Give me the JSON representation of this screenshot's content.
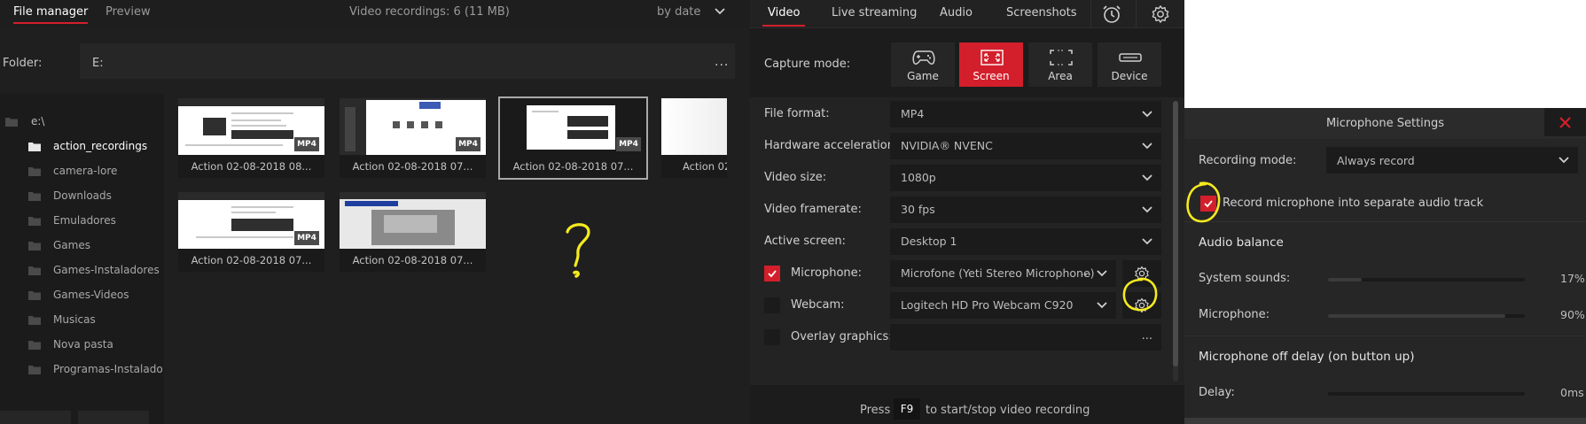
{
  "file_manager": {
    "tabs": [
      {
        "label": "File manager",
        "active": true
      },
      {
        "label": "Preview",
        "active": false
      }
    ],
    "recordings_count": "Video recordings: 6 (11 MB)",
    "sort": "by date",
    "folder_label": "Folder:",
    "folder_value": "E:",
    "folder_browse": "...",
    "tree": [
      {
        "label": "e:\\",
        "root": true
      },
      {
        "label": "action_recordings",
        "selected": true
      },
      {
        "label": "camera-lore"
      },
      {
        "label": "Downloads"
      },
      {
        "label": "Emuladores"
      },
      {
        "label": "Games"
      },
      {
        "label": "Games-Instaladores"
      },
      {
        "label": "Games-Videos"
      },
      {
        "label": "Musicas"
      },
      {
        "label": "Nova pasta"
      },
      {
        "label": "Programas-Instalado"
      }
    ],
    "thumbnails": [
      {
        "caption": "Action 02-08-2018 08...",
        "badge": "MP4"
      },
      {
        "caption": "Action 02-08-2018 07...",
        "badge": "MP4"
      },
      {
        "caption": "Action 02-08-2018 07...",
        "badge": "MP4",
        "selected": true
      },
      {
        "caption": "Action 02",
        "badge": ""
      },
      {
        "caption": "Action 02-08-2018 07...",
        "badge": "MP4"
      },
      {
        "caption": "Action 02-08-2018 07...",
        "badge": ""
      }
    ],
    "annotation_mark": "?"
  },
  "video_panel": {
    "tabs": [
      {
        "label": "Video",
        "active": true
      },
      {
        "label": "Live streaming"
      },
      {
        "label": "Audio"
      },
      {
        "label": "Screenshots"
      }
    ],
    "capture_label": "Capture mode:",
    "capture_modes": [
      {
        "label": "Game",
        "icon": "gamepad-icon"
      },
      {
        "label": "Screen",
        "icon": "screen-capture-icon",
        "active": true
      },
      {
        "label": "Area",
        "icon": "area-capture-icon"
      },
      {
        "label": "Device",
        "icon": "device-icon"
      }
    ],
    "settings": {
      "file_format": {
        "label": "File format:",
        "value": "MP4"
      },
      "hw_accel": {
        "label": "Hardware acceleration:",
        "value": "NVIDIA® NVENC"
      },
      "video_size": {
        "label": "Video size:",
        "value": "1080p"
      },
      "framerate": {
        "label": "Video framerate:",
        "value": "30 fps"
      },
      "active_screen": {
        "label": "Active screen:",
        "value": "Desktop 1"
      },
      "microphone": {
        "label": "Microphone:",
        "value": "Microfone (Yeti Stereo Microphone)",
        "more": "...",
        "checked": true
      },
      "webcam": {
        "label": "Webcam:",
        "value": "Logitech HD Pro Webcam C920",
        "checked": false
      },
      "overlay": {
        "label": "Overlay graphics:",
        "value": "",
        "more": "...",
        "checked": false
      }
    },
    "footer": {
      "press": "Press",
      "key": "F9",
      "rest": "to start/stop video recording"
    }
  },
  "mic_settings": {
    "title": "Microphone Settings",
    "recording_mode_label": "Recording mode:",
    "recording_mode_value": "Always record",
    "separate_track_label": "Record microphone into separate audio track",
    "separate_track_checked": true,
    "audio_balance_header": "Audio balance",
    "system_sounds_label": "System sounds:",
    "system_sounds_pct": "17%",
    "system_sounds_level": 0.17,
    "microphone_label": "Microphone:",
    "microphone_pct": "90%",
    "microphone_level": 0.9,
    "off_delay_header": "Microphone off delay (on button up)",
    "delay_label": "Delay:",
    "delay_value": "0ms",
    "delay_level": 0
  },
  "colors": {
    "accent": "#d31f2b",
    "annotation": "#f5ea1f"
  }
}
